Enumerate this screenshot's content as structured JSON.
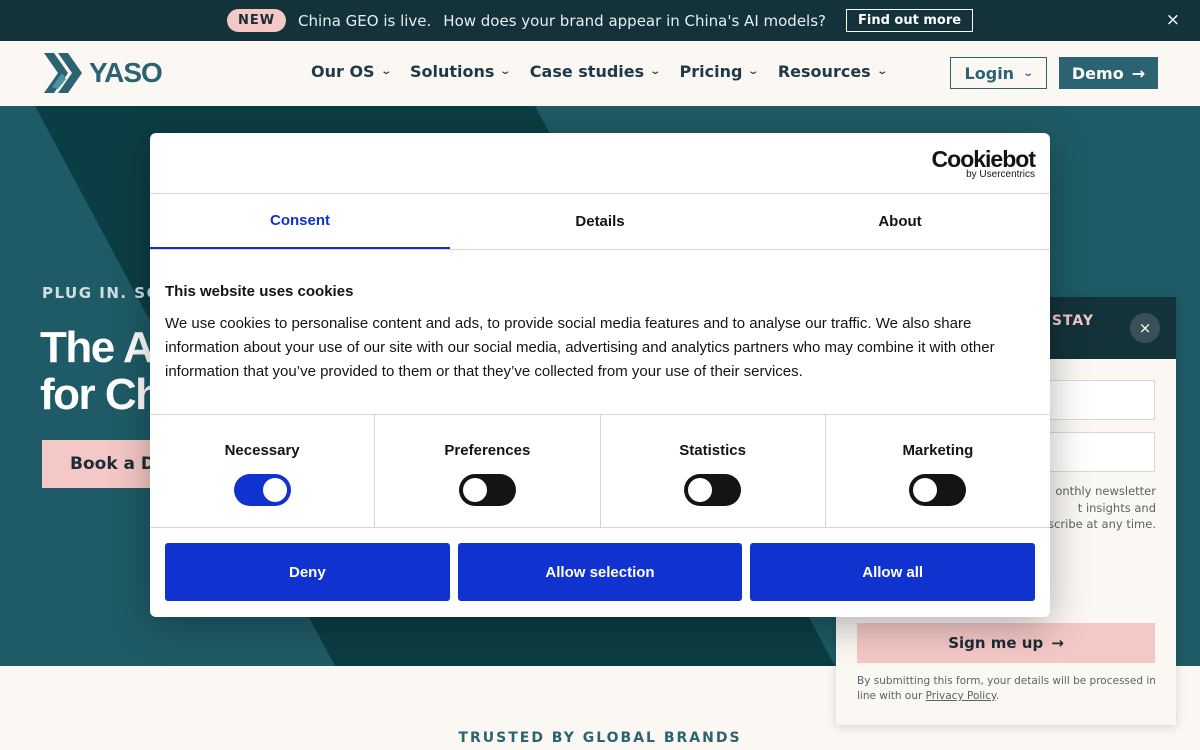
{
  "announcement": {
    "badge": "NEW",
    "text1": "China GEO is live.",
    "text2": "How does your brand appear in China's AI models?",
    "cta": "Find out more",
    "close_icon": "×"
  },
  "header": {
    "logo_text": "YASO",
    "nav": [
      "Our OS",
      "Solutions",
      "Case studies",
      "Pricing",
      "Resources"
    ],
    "login_label": "Login",
    "demo_label": "Demo"
  },
  "hero": {
    "eyebrow": "PLUG IN. SC",
    "title_line1": "The A",
    "title_line2": "for Ch",
    "button_label": "Book a D"
  },
  "trusted": {
    "label": "TRUSTED BY GLOBAL BRANDS"
  },
  "newsletter": {
    "header_text": "STAY",
    "close_icon": "×",
    "note_line1": "onthly newsletter",
    "note_line2": "t insights and",
    "note_line3": "scribe at any time.",
    "submit_label": "Sign me up",
    "legal_text": "By submitting this form, your details will be processed in line with our",
    "legal_link": "Privacy Policy",
    "legal_end": "."
  },
  "cookie_dialog": {
    "brand": "Cookiebot",
    "brand_sub": "by Usercentrics",
    "tabs": [
      "Consent",
      "Details",
      "About"
    ],
    "active_tab": "Consent",
    "heading": "This website uses cookies",
    "body": "We use cookies to personalise content and ads, to provide social media features and to analyse our traffic. We also share information about your use of our site with our social media, advertising and analytics partners who may combine it with other information that you’ve provided to them or that they’ve collected from your use of their services.",
    "categories": [
      {
        "label": "Necessary",
        "enabled": true
      },
      {
        "label": "Preferences",
        "enabled": false
      },
      {
        "label": "Statistics",
        "enabled": false
      },
      {
        "label": "Marketing",
        "enabled": false
      }
    ],
    "buttons": {
      "deny": "Deny",
      "allow_selection": "Allow selection",
      "allow_all": "Allow all"
    }
  },
  "colors": {
    "announce_bg": "#14323a",
    "brand_teal": "#2b6373",
    "hero_dark": "#0b3e44",
    "hero_light": "#1f5b66",
    "accent_pink": "#f4c8c6",
    "cookie_blue": "#1032cf"
  }
}
